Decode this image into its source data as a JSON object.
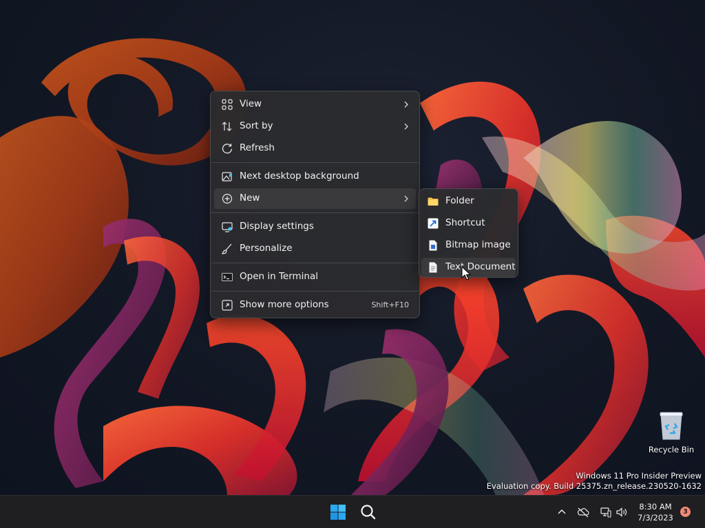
{
  "context_menu": {
    "items": [
      {
        "label": "View",
        "icon": "grid-view-icon",
        "has_submenu": true
      },
      {
        "label": "Sort by",
        "icon": "sort-icon",
        "has_submenu": true
      },
      {
        "label": "Refresh",
        "icon": "refresh-icon"
      },
      {
        "label": "Next desktop background",
        "icon": "next-background-icon"
      },
      {
        "label": "New",
        "icon": "new-plus-icon",
        "has_submenu": true,
        "highlighted": true
      },
      {
        "label": "Display settings",
        "icon": "display-settings-icon"
      },
      {
        "label": "Personalize",
        "icon": "personalize-brush-icon"
      },
      {
        "label": "Open in Terminal",
        "icon": "terminal-icon"
      },
      {
        "label": "Show more options",
        "icon": "more-options-icon",
        "shortcut": "Shift+F10"
      }
    ]
  },
  "new_submenu": {
    "items": [
      {
        "label": "Folder",
        "icon": "folder-icon"
      },
      {
        "label": "Shortcut",
        "icon": "shortcut-icon"
      },
      {
        "label": "Bitmap image",
        "icon": "bitmap-image-icon"
      },
      {
        "label": "Text Document",
        "icon": "text-document-icon",
        "highlighted": true
      }
    ]
  },
  "desktop": {
    "recycle_bin_label": "Recycle Bin",
    "watermark_line1": "Windows 11 Pro Insider Preview",
    "watermark_line2": "Evaluation copy. Build 25375.zn_release.230520-1632"
  },
  "taskbar": {
    "start_icon": "windows-start-icon",
    "search_icon": "search-icon",
    "tray_icons": [
      "chevron-up-icon",
      "onedrive-offline-icon",
      "network-icon",
      "volume-icon"
    ],
    "time": "8:30 AM",
    "date": "7/3/2023",
    "notification_count": "3"
  },
  "colors": {
    "menu_bg": "#2b2b2e",
    "menu_hover": "#3a3a3d",
    "accent_blue": "#4cc2ff",
    "notif_badge": "#f08a75"
  }
}
